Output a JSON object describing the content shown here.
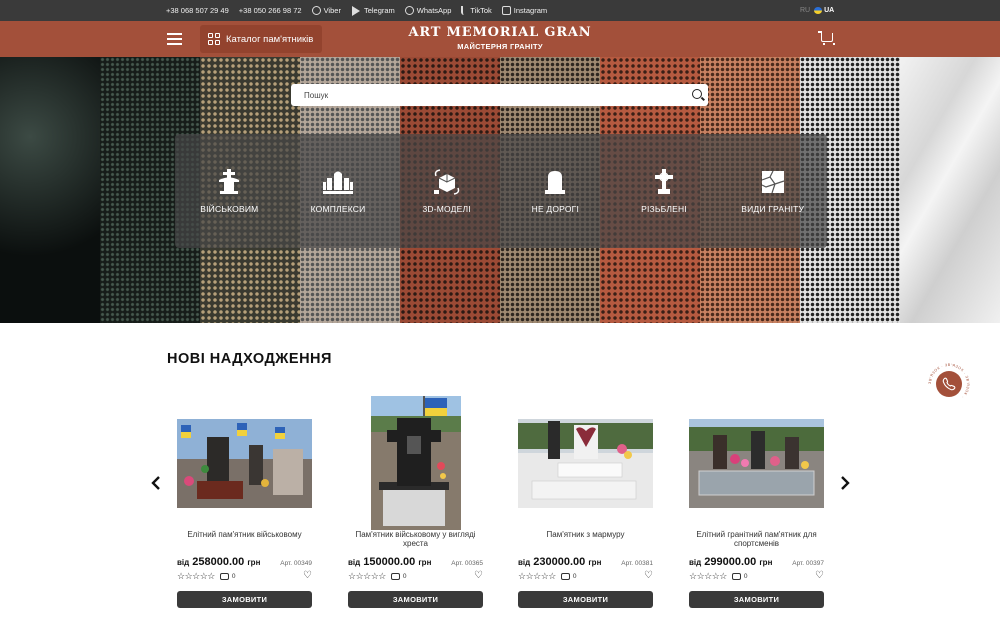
{
  "topbar": {
    "phone1": "+38 068 507 29 49",
    "phone2": "+38 050 266 98 72",
    "socials": [
      {
        "label": "Viber",
        "icon": "viber-icon"
      },
      {
        "label": "Telegram",
        "icon": "telegram-icon"
      },
      {
        "label": "WhatsApp",
        "icon": "whatsapp-icon"
      },
      {
        "label": "TikTok",
        "icon": "tiktok-icon"
      },
      {
        "label": "Instagram",
        "icon": "instagram-icon"
      }
    ],
    "lang_ru": "RU",
    "lang_ua": "UA"
  },
  "header": {
    "catalog_label": "Каталог пам'ятників",
    "logo_title": "ART MEMORIAL GRAN",
    "logo_subtitle": "МАЙСТЕРНЯ ГРАНІТУ",
    "brand_color": "#a3503a"
  },
  "search": {
    "placeholder": "Пошук"
  },
  "categories": [
    {
      "label": "ВІЙСЬКОВИМ",
      "icon": "military-monument-icon"
    },
    {
      "label": "КОМПЛЕКСИ",
      "icon": "complex-icon"
    },
    {
      "label": "3D-МОДЕЛІ",
      "icon": "3d-model-icon"
    },
    {
      "label": "НЕ ДОРОГІ",
      "icon": "tombstone-icon"
    },
    {
      "label": "РІЗЬБЛЕНІ",
      "icon": "carved-cross-icon"
    },
    {
      "label": "ВИДИ ГРАНІТУ",
      "icon": "granite-types-icon"
    }
  ],
  "section": {
    "title": "НОВІ НАДХОДЖЕННЯ"
  },
  "products": [
    {
      "name": "Елітний пам'ятник військовому",
      "price_prefix": "від",
      "price": "258000.00",
      "currency": "грн",
      "art": "Арт. 00349",
      "comments": "0",
      "order_label": "ЗАМОВИТИ"
    },
    {
      "name": "Пам'ятник військовому у вигляді хреста",
      "price_prefix": "від",
      "price": "150000.00",
      "currency": "грн",
      "art": "Арт. 00365",
      "comments": "0",
      "order_label": "ЗАМОВИТИ"
    },
    {
      "name": "Пам'ятник з мармуру",
      "price_prefix": "від",
      "price": "230000.00",
      "currency": "грн",
      "art": "Арт. 00381",
      "comments": "0",
      "order_label": "ЗАМОВИТИ"
    },
    {
      "name": "Елітний гранітний пам'ятник для спортсменів",
      "price_prefix": "від",
      "price": "299000.00",
      "currency": "грн",
      "art": "Арт. 00397",
      "comments": "0",
      "order_label": "ЗАМОВИТИ"
    }
  ],
  "callback": {
    "ring_text": "ЗВ'ЯЗОК · ЗВ'ЯЗОК · ЗВ'ЯЗОК ·",
    "icon": "phone-icon"
  }
}
